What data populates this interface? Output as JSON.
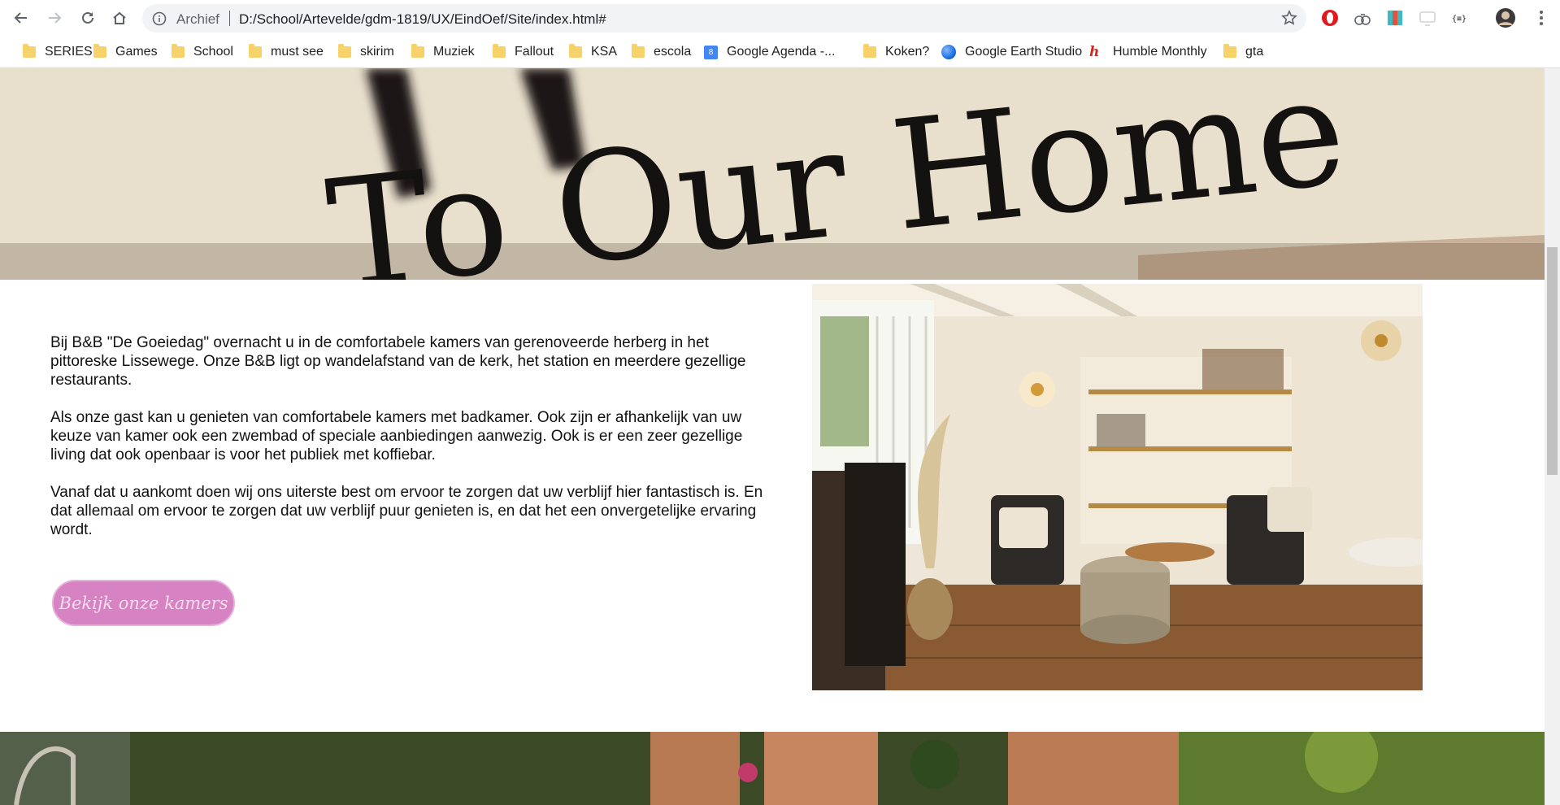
{
  "browser": {
    "address_label": "Archief",
    "url": "D:/School/Artevelde/gdm-1819/UX/EindOef/Site/index.html#",
    "bookmarks": [
      {
        "label": "SERIES",
        "icon": "folder-icon"
      },
      {
        "label": "Games",
        "icon": "folder-icon"
      },
      {
        "label": "School",
        "icon": "folder-icon"
      },
      {
        "label": "must see",
        "icon": "folder-icon"
      },
      {
        "label": "skirim",
        "icon": "folder-icon"
      },
      {
        "label": "Muziek",
        "icon": "folder-icon"
      },
      {
        "label": "Fallout",
        "icon": "folder-icon"
      },
      {
        "label": "KSA",
        "icon": "folder-icon"
      },
      {
        "label": "escola",
        "icon": "folder-icon"
      },
      {
        "label": "Google Agenda -...",
        "icon": "calendar-icon",
        "badge": "8"
      },
      {
        "label": "Koken?",
        "icon": "folder-icon"
      },
      {
        "label": "Google Earth Studio",
        "icon": "earth-icon"
      },
      {
        "label": "Humble Monthly",
        "icon": "humble-icon"
      },
      {
        "label": "gta",
        "icon": "folder-icon"
      }
    ],
    "extension_icons": [
      "opera-icon",
      "extension-icon",
      "extension-icon",
      "extension-icon",
      "json-icon",
      "profile-icon"
    ]
  },
  "page": {
    "hero_sign_text": "To Our Home",
    "intro_paragraphs": [
      "Bij B&B \"De Goeiedag\" overnacht u in de comfortabele kamers van gerenoveerde herberg in het pittoreske Lissewege. Onze B&B ligt op wandelafstand van de kerk, het station en meerdere gezellige restaurants.",
      "Als onze gast kan u genieten van comfortabele kamers met badkamer. Ook zijn er afhankelijk van uw keuze van kamer ook een zwembad of speciale aanbiedingen aanwezig. Ook is er een zeer gezellige living dat ook openbaar is voor het publiek met koffiebar.",
      "Vanaf dat u aankomt doen wij ons uiterste best om ervoor te zorgen dat uw verblijf hier fantastisch is. En dat allemaal om ervoor te zorgen dat uw verblijf puur genieten is, en dat het een onvergetelijke ervaring wordt."
    ],
    "cta_label": "Bekijk onze kamers"
  },
  "colors": {
    "cta_background": "#d682c3",
    "cta_text": "#f6dcef",
    "omnibox_background": "#f1f3f4",
    "folder": "#f7d16a"
  }
}
